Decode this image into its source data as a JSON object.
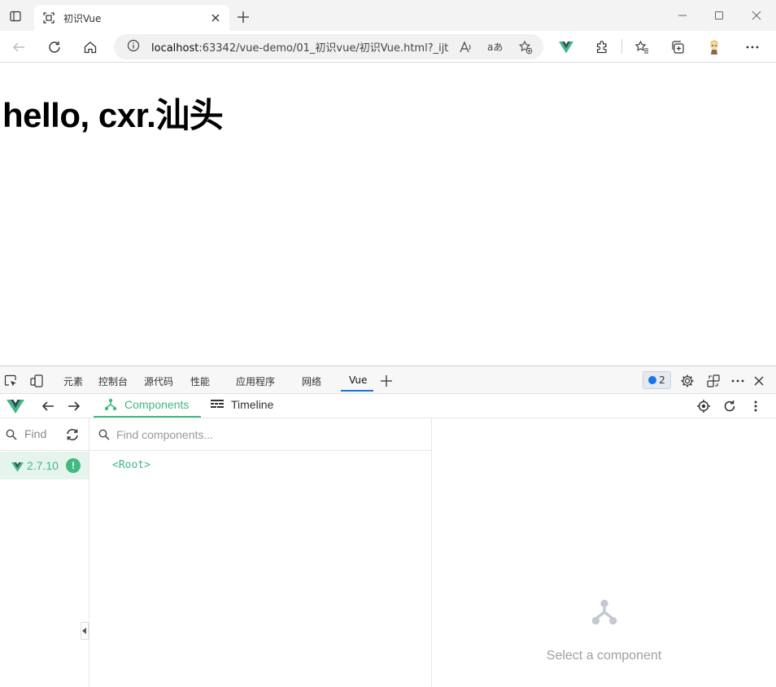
{
  "browser": {
    "tab": {
      "title": "初识Vue"
    },
    "address": {
      "url_host": "localhost",
      "url_rest": ":63342/vue-demo/01_初识vue/初识Vue.html?_ijt..."
    }
  },
  "page": {
    "heading": "hello, cxr.汕头"
  },
  "devtools": {
    "tabs": [
      "元素",
      "控制台",
      "源代码",
      "性能",
      "应用程序",
      "网络",
      "Vue"
    ],
    "active_tab": "Vue",
    "issues_count": "2"
  },
  "vue_devtools": {
    "tabs": {
      "components": "Components",
      "timeline": "Timeline"
    },
    "app_find_label": "Find",
    "app_version": "2.7.10",
    "app_warning_symbol": "!",
    "component_search_placeholder": "Find components...",
    "root_node": "<Root>",
    "empty_state": "Select a component",
    "accent_color": "#42b883"
  }
}
